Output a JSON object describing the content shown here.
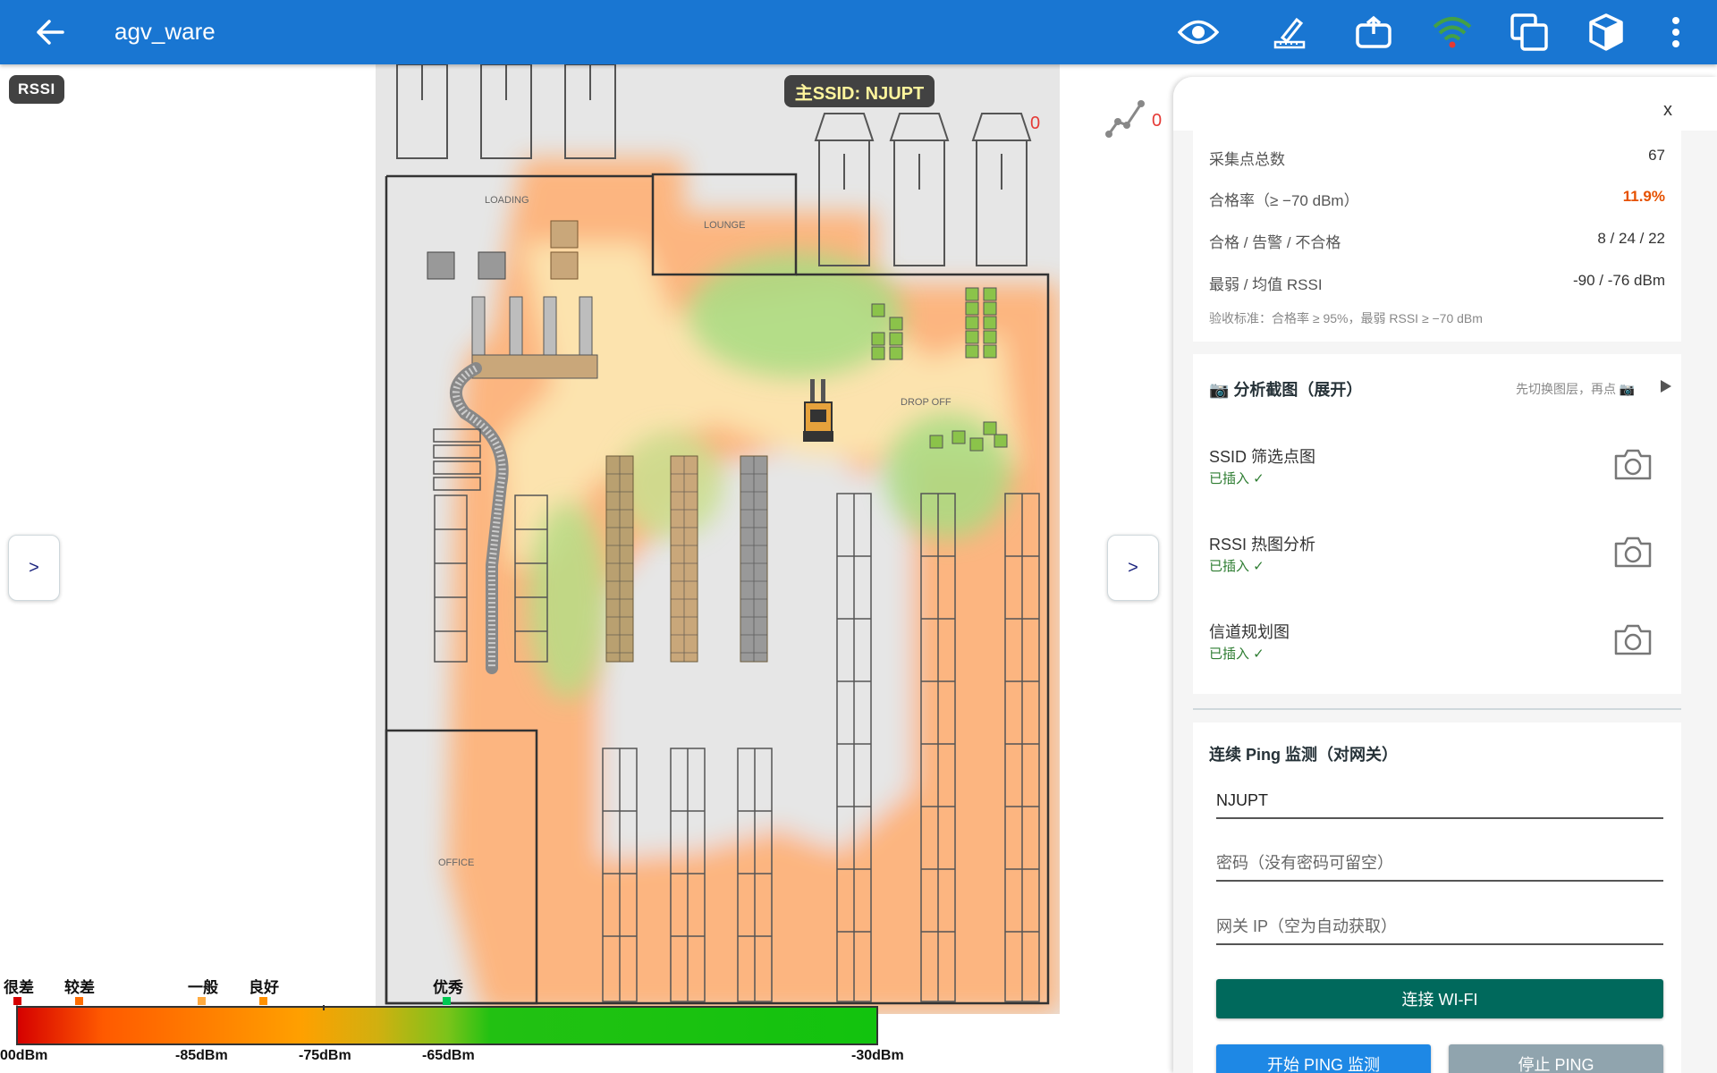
{
  "appbar": {
    "title": "agv_ware",
    "icons": [
      "back-arrow-icon",
      "eye-icon",
      "ruler-pen-icon",
      "share-box-icon",
      "wifi-signal-icon",
      "copy-layers-icon",
      "cube-icon",
      "more-vert-icon"
    ]
  },
  "map": {
    "layer_chip": "RSSI",
    "ssid_pill": "主SSID: NJUPT",
    "route_count": "0",
    "truck_count": "0",
    "zones": {
      "loading": "LOADING",
      "lounge": "LOUNGE",
      "drop_off": "DROP OFF",
      "office": "OFFICE"
    },
    "left_toggle": ">",
    "right_toggle": ">"
  },
  "legend": {
    "levels": [
      {
        "label": "很差",
        "color": "#d50000"
      },
      {
        "label": "较差",
        "color": "#ff6d00"
      },
      {
        "label": "一般",
        "color": "#ffab40"
      },
      {
        "label": "良好",
        "color": "#ff9100"
      },
      {
        "label": "优秀",
        "color": "#00c853"
      }
    ],
    "ticks": [
      "00dBm",
      "-85dBm",
      "-75dBm",
      "-65dBm",
      "-30dBm"
    ]
  },
  "panel": {
    "close": "x",
    "stats": [
      {
        "label": "采集点总数",
        "value": "67"
      },
      {
        "label": "合格率（≥ −70 dBm）",
        "value": "11.9%"
      },
      {
        "label": "合格 / 告警 / 不合格",
        "value": "8 / 24 / 22"
      },
      {
        "label": "最弱 / 均值 RSSI",
        "value": "-90 / -76 dBm"
      }
    ],
    "criteria": "验收标准：合格率 ≥ 95%，最弱 RSSI ≥ −70 dBm",
    "snapshots": {
      "title": "📷 分析截图（展开）",
      "hint": "先切换图层，再点 📷",
      "items": [
        {
          "label": "SSID 筛选点图",
          "status": "已插入 ✓"
        },
        {
          "label": "RSSI 热图分析",
          "status": "已插入 ✓"
        },
        {
          "label": "信道规划图",
          "status": "已插入 ✓"
        }
      ]
    },
    "ping": {
      "title": "连续 Ping 监测（对网关）",
      "ssid_value": "NJUPT",
      "password_placeholder": "密码（没有密码可留空）",
      "gateway_placeholder": "网关 IP（空为自动获取）",
      "connect_button": "连接 WI-FI",
      "start_button": "开始 PING 监测",
      "stop_button": "停止 PING"
    }
  },
  "colors": {
    "appbar": "#1976d2",
    "connect": "#00695c",
    "start": "#1e88e5",
    "stop": "#90a4ae",
    "alert": "#e65100",
    "ok": "#2e7d32"
  }
}
